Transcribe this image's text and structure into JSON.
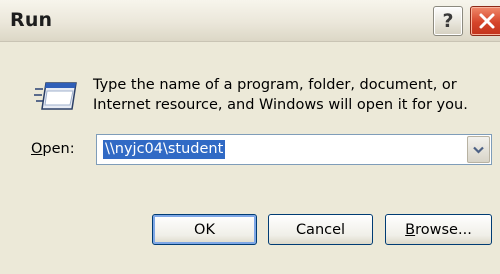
{
  "window": {
    "title": "Run"
  },
  "titlebar": {
    "help_glyph": "?",
    "help_icon": "help-icon",
    "close_icon": "close-icon"
  },
  "dialog": {
    "icon": "run-program-icon",
    "description_line1": "Type the name of a program, folder, document, or",
    "description_line2": "Internet resource, and Windows will open it for you.",
    "open_label_accel": "O",
    "open_label_rest": "pen:",
    "open_value": "\\\\nyjc04\\student",
    "dropdown_icon": "chevron-down-icon"
  },
  "buttons": {
    "ok": "OK",
    "cancel": "Cancel",
    "browse_accel": "B",
    "browse_rest": "rowse..."
  },
  "colors": {
    "dialog_bg": "#ece9d8",
    "selection": "#316ac5",
    "close_button": "#d6452a",
    "input_border": "#7f9db9",
    "default_button_focus": "#7ea7e6"
  }
}
